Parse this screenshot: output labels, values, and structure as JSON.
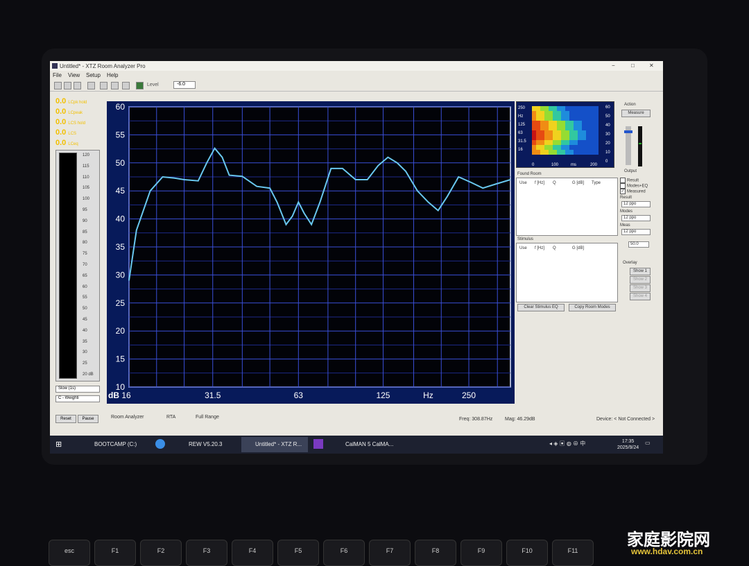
{
  "window": {
    "title": "Untitled* - XTZ Room Analyzer Pro",
    "min": "−",
    "max": "□",
    "close": "✕"
  },
  "menu": [
    "File",
    "View",
    "Setup",
    "Help"
  ],
  "toolbar": {
    "level_label": "Level",
    "level_value": "-6.0"
  },
  "meters": [
    {
      "value": "0.0",
      "label": "LCpk hold"
    },
    {
      "value": "0.0",
      "label": "LCpeak"
    },
    {
      "value": "0.0",
      "label": "LCS hold"
    },
    {
      "value": "0.0",
      "label": "LCS"
    },
    {
      "value": "0.0",
      "label": "LCeq"
    }
  ],
  "meter_scale": [
    "120",
    "115",
    "110",
    "105",
    "100",
    "95",
    "90",
    "85",
    "80",
    "75",
    "70",
    "65",
    "60",
    "55",
    "50",
    "45",
    "40",
    "35",
    "30",
    "25",
    "20 dB"
  ],
  "meter_controls": {
    "speed": "Slow (1s)",
    "weighting": "C - Weighti",
    "reset": "Reset",
    "pause": "Pause"
  },
  "graph": {
    "y_ticks": [
      "60",
      "55",
      "50",
      "45",
      "40",
      "35",
      "30",
      "25",
      "20",
      "15",
      "10"
    ],
    "x_ticks": [
      "16",
      "31.5",
      "63",
      "125",
      "Hz",
      "250"
    ],
    "y_unit": "dB",
    "tabs": [
      "Room Analyzer",
      "RTA",
      "Full Range"
    ]
  },
  "chart_data": {
    "type": "line",
    "ylabel": "dB",
    "xlabel": "Hz",
    "ylim": [
      10,
      60
    ],
    "x_scale": "log",
    "xlim": [
      16,
      350
    ],
    "series": [
      {
        "x": [
          16,
          17,
          19,
          21,
          23,
          25,
          28,
          30,
          32,
          34,
          36,
          40,
          45,
          50,
          53,
          57,
          60,
          63,
          66,
          70,
          75,
          82,
          90,
          100,
          110,
          120,
          130,
          140,
          150,
          165,
          180,
          195,
          210,
          230,
          255,
          280,
          310,
          350
        ],
        "y": [
          29,
          38,
          45,
          47.5,
          47.3,
          47,
          46.8,
          50,
          52.6,
          51,
          47.8,
          47.6,
          45.8,
          45.5,
          43,
          39,
          40.5,
          43,
          41,
          39,
          43,
          49,
          49,
          47,
          47,
          49.5,
          51,
          50,
          48.5,
          45,
          43,
          41.5,
          44,
          47.5,
          46.5,
          45.5,
          46.2,
          47
        ]
      }
    ]
  },
  "side": {
    "heatmap_x": [
      "0",
      "100",
      "ms",
      "200"
    ],
    "heatmap_y": [
      "250",
      "Hz",
      "125",
      "63",
      "31.5",
      "16"
    ],
    "heatmap_scale": [
      "60",
      "50",
      "40",
      "30",
      "20",
      "10",
      "0"
    ],
    "action_label": "Action",
    "measure": "Measure",
    "output_label": "Output",
    "room_mode_label": "Found Room",
    "room_cols": [
      "Use",
      "f [Hz]",
      "Q",
      "G [dB]",
      "Type"
    ],
    "stimulus_label": "Stimulus",
    "stim_cols": [
      "Use",
      "f [Hz]",
      "Q",
      "G [dB]"
    ],
    "checks": [
      {
        "label": "Result",
        "checked": false
      },
      {
        "label": "Modes+EQ",
        "checked": false
      },
      {
        "label": "Measured",
        "checked": true
      }
    ],
    "result_label": "Result",
    "result_value": "12 ppo",
    "modes_label": "Modes",
    "modes_value": "12 ppo",
    "meas_label": "Meas",
    "meas_value": "12 ppo",
    "num_value": "50.0",
    "overlay_label": "Overlay",
    "overlays": [
      "Show 1",
      "Show 2",
      "Show 3",
      "Show 4"
    ],
    "clear_btn": "Clear Stimulus EQ",
    "copy_btn": "Copy Room Modes"
  },
  "status": {
    "freq": "Freq: 308.87Hz",
    "mag": "Mag: 46.29dB",
    "device": "Device: < Not Connected >"
  },
  "taskbar": {
    "items": [
      "BOOTCAMP (C:)",
      "REW V5.20.3",
      "Untitled* - XTZ R...",
      "CalMAN 5 CalMA..."
    ],
    "time": "17:35",
    "date": "2025/9/24"
  },
  "keys": [
    "esc",
    "F1",
    "F2",
    "F3",
    "F4",
    "F5",
    "F6",
    "F7",
    "F8",
    "F9",
    "F10",
    "F11"
  ],
  "watermark": {
    "text": "家庭影院网",
    "url": "www.hdav.com.cn"
  }
}
